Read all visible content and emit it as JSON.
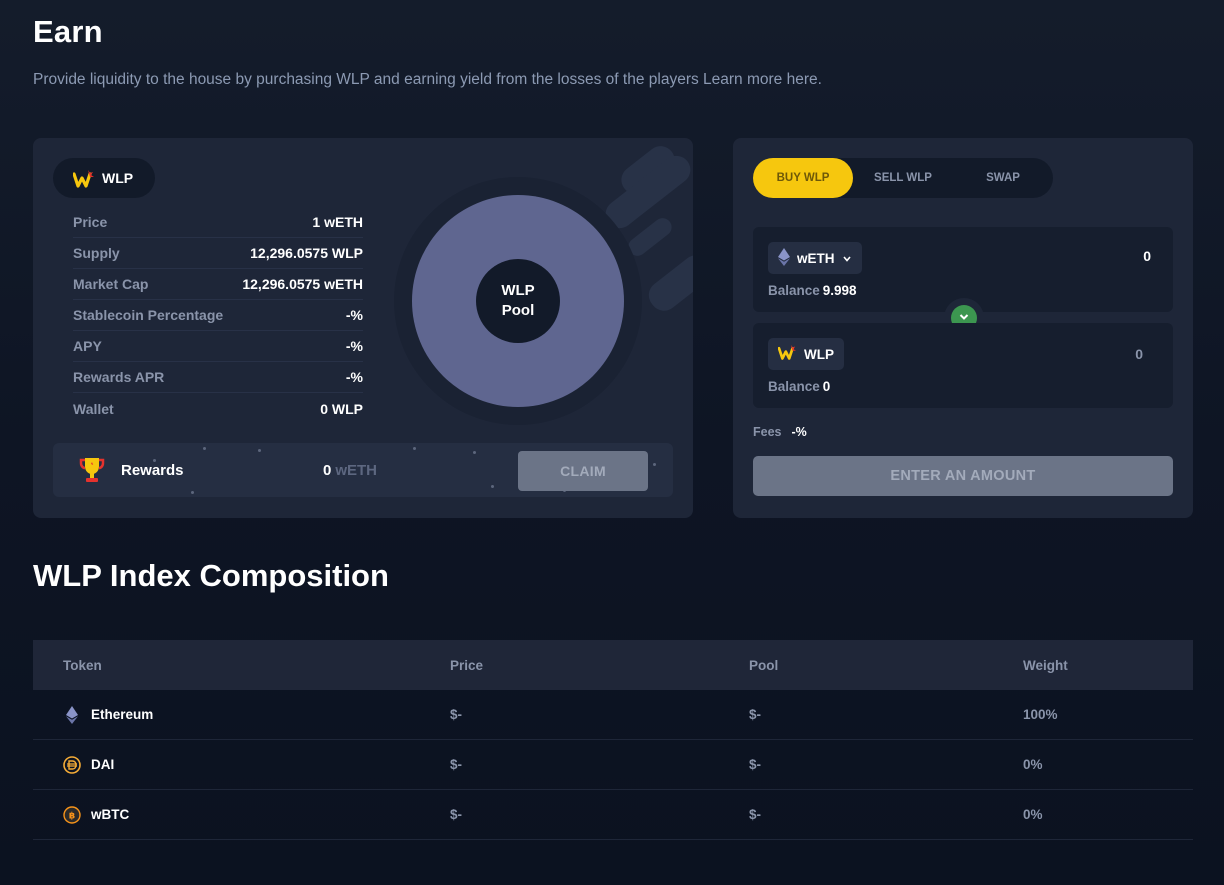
{
  "header": {
    "title": "Earn",
    "subtitle": "Provide liquidity to the house by purchasing WLP and earning yield from the losses of the players Learn more here."
  },
  "pool_card": {
    "chip_label": "WLP",
    "stats": [
      {
        "label": "Price",
        "value": "1 wETH"
      },
      {
        "label": "Supply",
        "value": "12,296.0575 WLP"
      },
      {
        "label": "Market Cap",
        "value": "12,296.0575 wETH"
      },
      {
        "label": "Stablecoin Percentage",
        "value": "-%"
      },
      {
        "label": "APY",
        "value": "-%"
      },
      {
        "label": "Rewards APR",
        "value": "-%"
      },
      {
        "label": "Wallet",
        "value": "0 WLP"
      }
    ],
    "donut": {
      "line1": "WLP",
      "line2": "Pool",
      "segments": [
        {
          "token": "Ethereum",
          "weight": 100,
          "color": "#5f6690"
        }
      ]
    },
    "rewards": {
      "label": "Rewards",
      "amount": "0",
      "unit": "wETH",
      "claim_label": "CLAIM"
    }
  },
  "trade_card": {
    "tabs": [
      {
        "label": "BUY WLP",
        "active": true
      },
      {
        "label": "SELL WLP",
        "active": false
      },
      {
        "label": "SWAP",
        "active": false
      }
    ],
    "from": {
      "token": "wETH",
      "balance_label": "Balance",
      "balance": "9.998",
      "amount": "0"
    },
    "to": {
      "token": "WLP",
      "balance_label": "Balance",
      "balance": "0",
      "amount": "0"
    },
    "fees_label": "Fees",
    "fees_value": "-%",
    "submit_label": "ENTER AN AMOUNT"
  },
  "composition": {
    "title": "WLP Index Composition",
    "columns": [
      "Token",
      "Price",
      "Pool",
      "Weight"
    ],
    "rows": [
      {
        "token": "Ethereum",
        "icon": "ethereum-icon",
        "price": "$-",
        "pool": "$-",
        "weight": "100%"
      },
      {
        "token": "DAI",
        "icon": "dai-icon",
        "price": "$-",
        "pool": "$-",
        "weight": "0%"
      },
      {
        "token": "wBTC",
        "icon": "bitcoin-icon",
        "price": "$-",
        "pool": "$-",
        "weight": "0%"
      }
    ]
  },
  "colors": {
    "accent": "#f6c70e",
    "success": "#3c9650",
    "pool_fill": "#5f6690",
    "card": "#1e2638",
    "background": "#0e1524"
  }
}
